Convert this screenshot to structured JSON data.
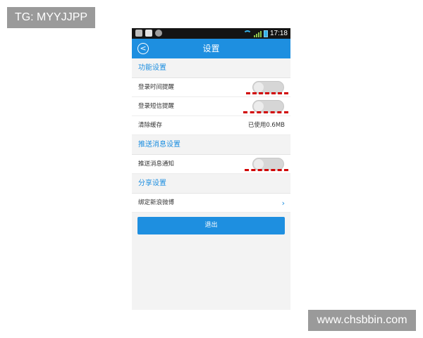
{
  "watermarks": {
    "top_left": "TG: MYYJJPP",
    "bottom_right": "www.chsbbin.com"
  },
  "status_bar": {
    "time": "17:18",
    "icons": [
      "shield-icon",
      "image-icon",
      "usb-icon",
      "wifi-icon",
      "signal-icon",
      "battery-icon"
    ]
  },
  "header": {
    "title": "设置",
    "back_icon": "back-circle-icon"
  },
  "sections": {
    "feature": {
      "title": "功能设置",
      "items": [
        {
          "label": "登录时间提醒",
          "control": "toggle",
          "state": "off"
        },
        {
          "label": "登录短信提醒",
          "control": "toggle",
          "state": "off"
        },
        {
          "label": "清除缓存",
          "value": "已使用0.6MB"
        }
      ]
    },
    "push": {
      "title": "推送消息设置",
      "items": [
        {
          "label": "推送消息通知",
          "control": "toggle",
          "state": "off"
        }
      ]
    },
    "share": {
      "title": "分享设置",
      "items": [
        {
          "label": "绑定新浪微博",
          "chevron": "›"
        }
      ]
    }
  },
  "logout_button": "退出",
  "colors": {
    "accent": "#1e8fe0",
    "annotation": "#d10000",
    "watermark_bg": "#9a9a9a"
  }
}
